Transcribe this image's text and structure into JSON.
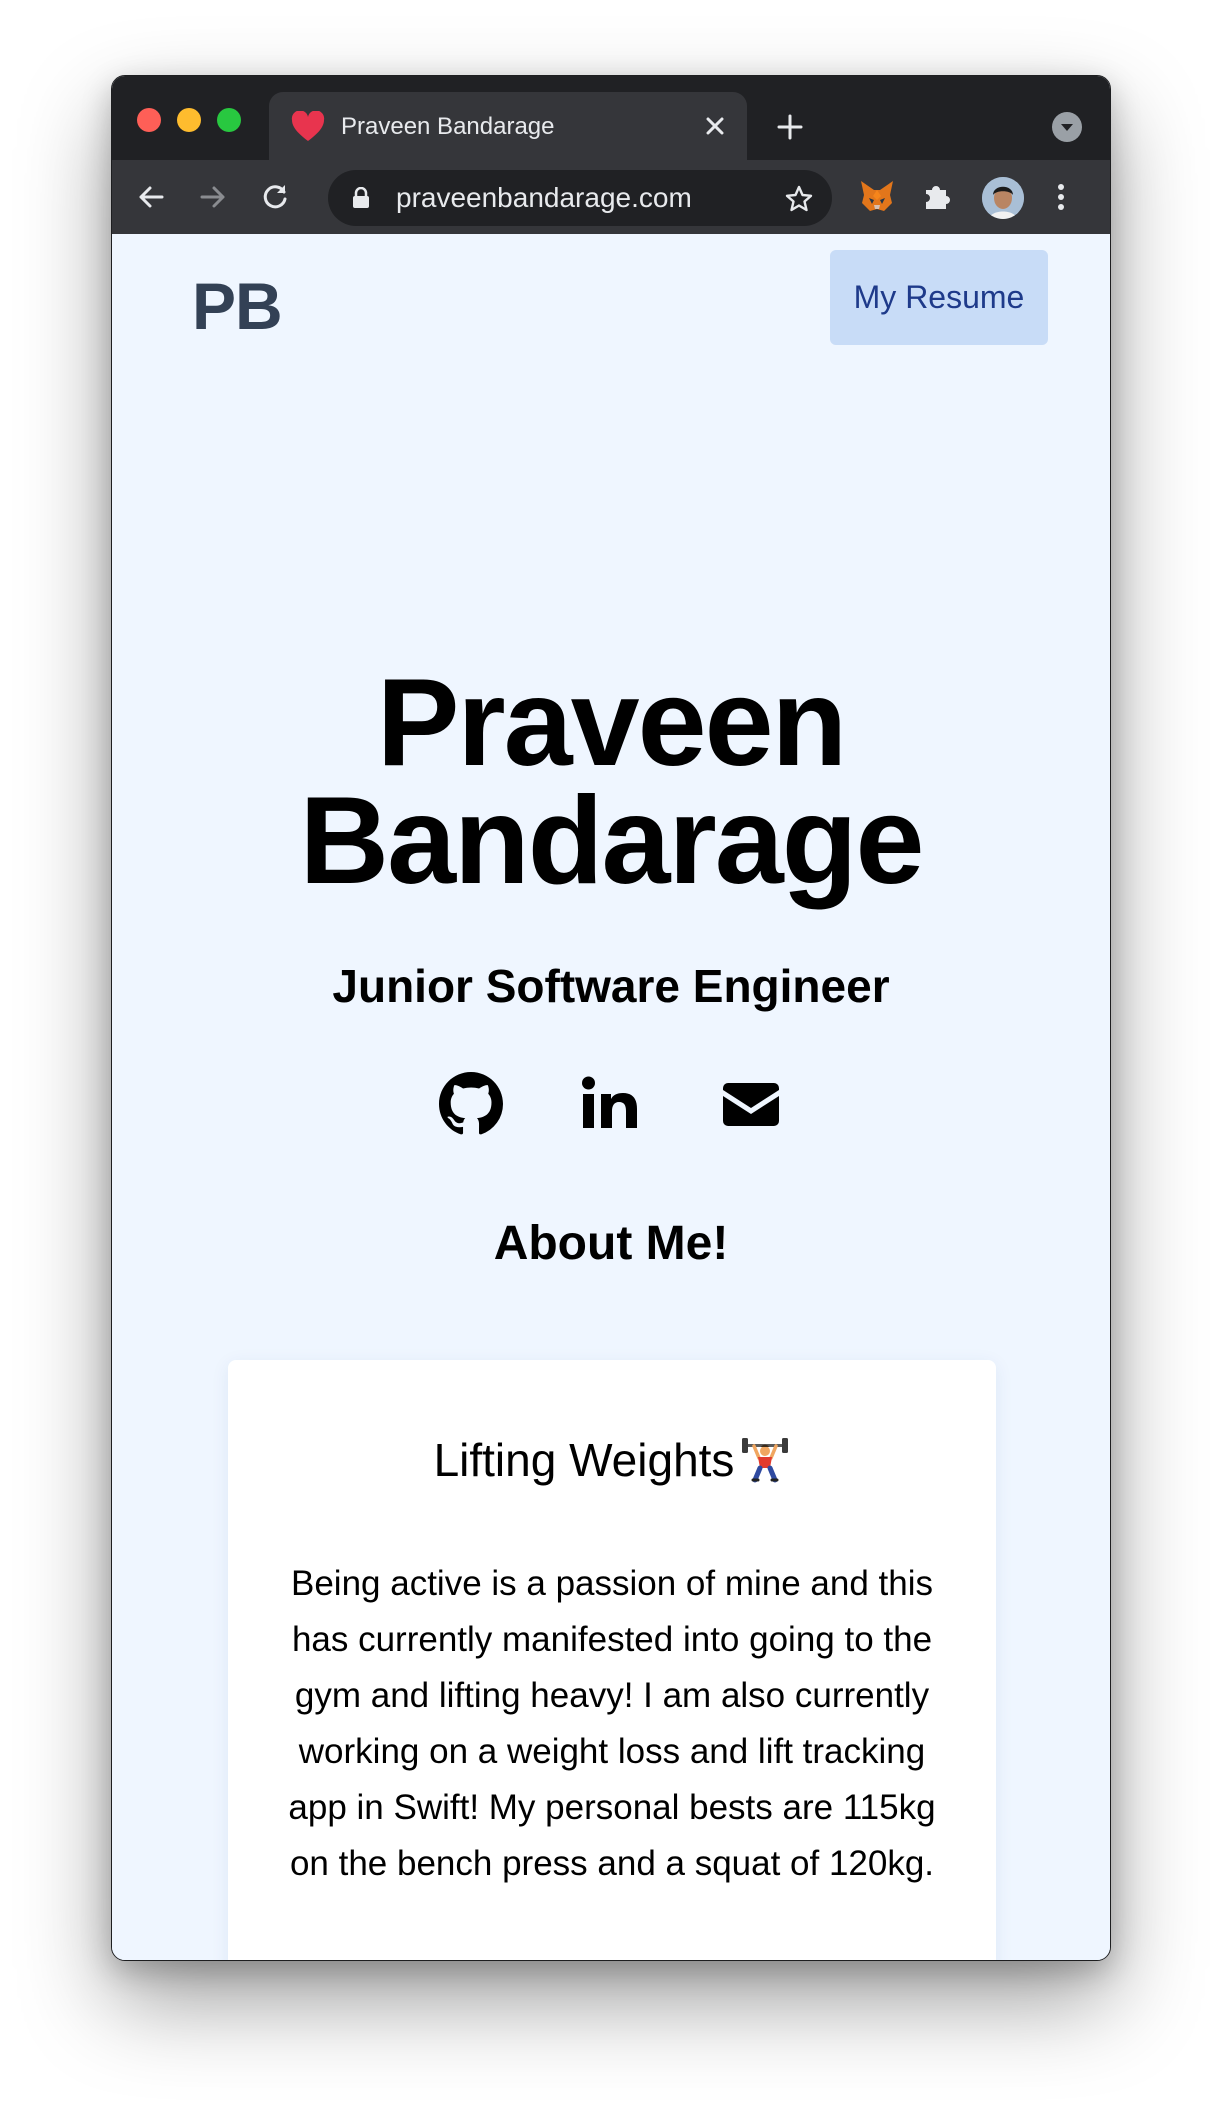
{
  "browser": {
    "tab_title": "Praveen Bandarage",
    "url": "praveenbandarage.com",
    "icons": {
      "favicon": "heart-icon",
      "close": "close-icon",
      "new_tab": "plus-icon",
      "back": "arrow-left-icon",
      "forward": "arrow-right-icon",
      "reload": "reload-icon",
      "lock": "lock-icon",
      "bookmark": "star-icon",
      "extension_fox": "metamask-fox-icon",
      "extensions": "puzzle-icon",
      "menu": "vertical-dots-icon"
    },
    "colors": {
      "frame": "#202124",
      "toolbar": "#35363a",
      "favicon": "#e8344e"
    }
  },
  "header": {
    "logo": "PB",
    "resume_button": "My Resume"
  },
  "hero": {
    "name_line1": "Praveen",
    "name_line2": "Bandarage",
    "subtitle": "Junior Software Engineer",
    "socials": [
      "github-icon",
      "linkedin-icon",
      "envelope-icon"
    ]
  },
  "about": {
    "heading": "About Me!",
    "card": {
      "title": "Lifting Weights",
      "emoji": "weightlifter-emoji",
      "body": "Being active is a passion of mine and this has currently manifested into going to the gym and lifting heavy! I am also currently working on a weight loss and lift tracking app in Swift! My personal bests are 115kg on the bench press and a squat of 120kg."
    }
  },
  "colors": {
    "page_background": "#eff6ff",
    "logo": "#334155",
    "resume_button_bg": "#c8dcf7",
    "resume_button_text": "#1e3a8a"
  }
}
